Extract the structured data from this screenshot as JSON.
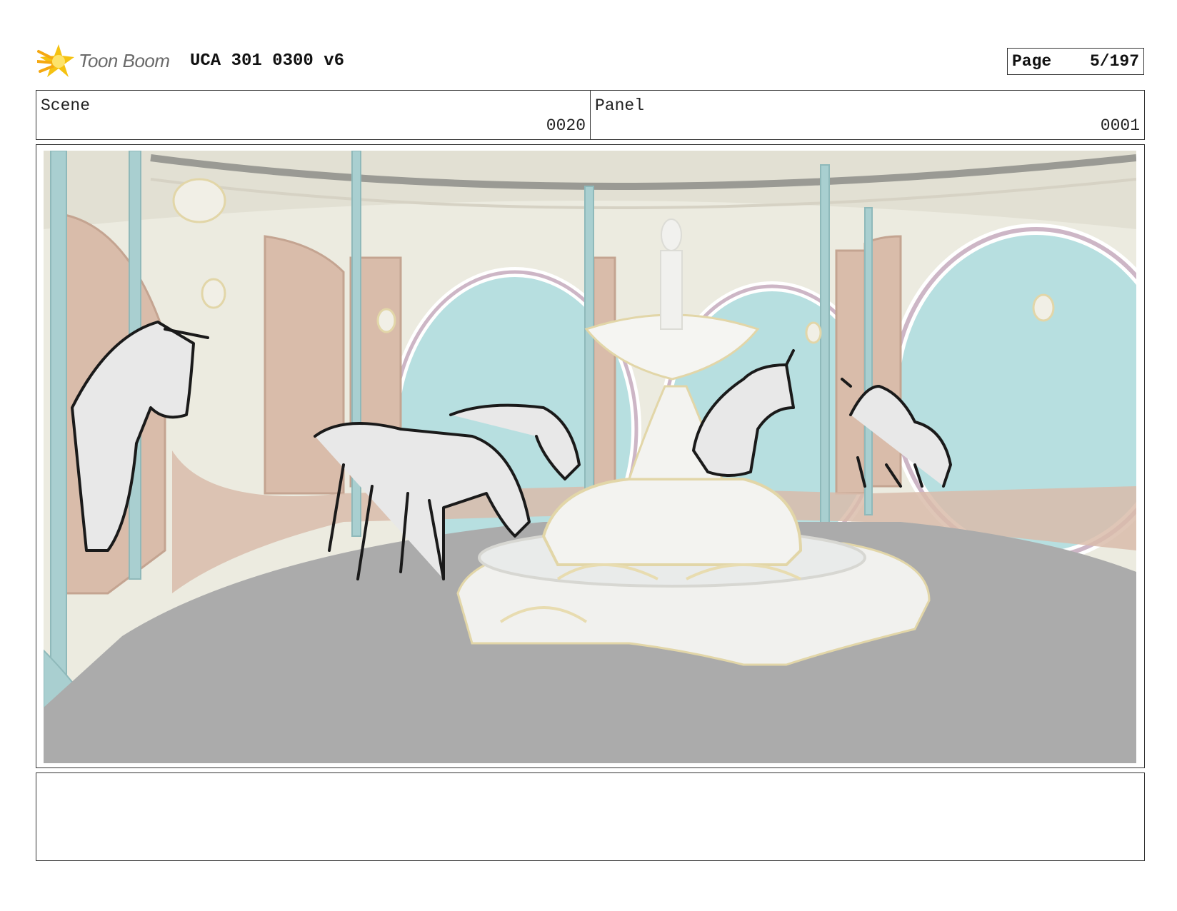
{
  "header": {
    "brand": "Toon Boom",
    "project_title": "UCA 301 0300 v6",
    "page_label": "Page",
    "page_value": "5/197"
  },
  "fields": {
    "scene_label": "Scene",
    "scene_value": "0020",
    "panel_label": "Panel",
    "panel_value": "0001"
  },
  "panel": {
    "notes": ""
  },
  "colors": {
    "wall": "#ecebe0",
    "floor": "#ababab",
    "pillar": "#a9cfd0",
    "door": "#d9bcaa",
    "window": "#b7dfe0",
    "trim": "#e8dcb0",
    "fountain": "#f1f1ee",
    "sketch": "#1a1a1a",
    "logo_accent": "#f5c211"
  }
}
